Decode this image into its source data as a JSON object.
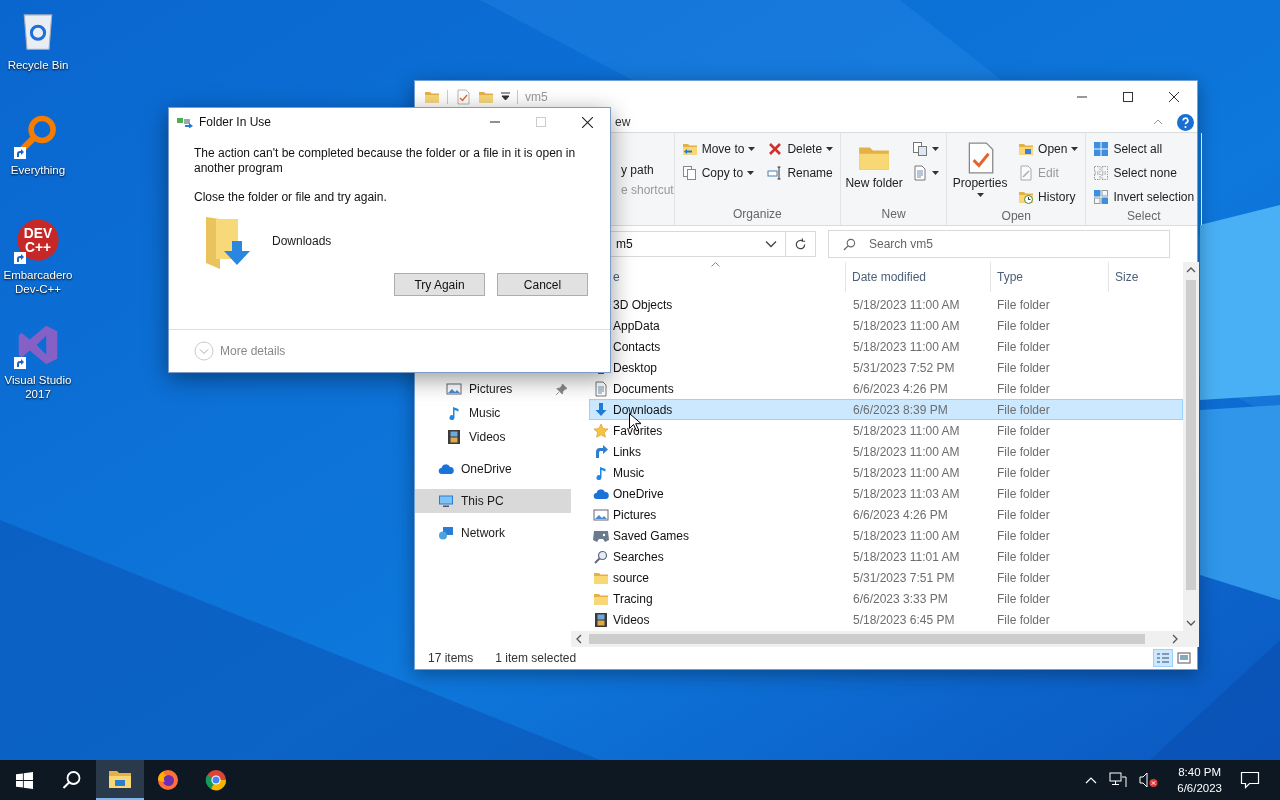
{
  "desktop_icons": [
    {
      "label": "Recycle Bin",
      "shortcut": false
    },
    {
      "label": "Everything",
      "shortcut": true
    },
    {
      "label": "Embarcadero Dev-C++",
      "shortcut": true,
      "logo_lines": [
        "DEV",
        "C++"
      ]
    },
    {
      "label": "Visual Studio 2017",
      "shortcut": true
    }
  ],
  "explorer": {
    "title": "vm5",
    "ribbon_tabs": [
      {
        "label": "ew",
        "selected": false
      }
    ],
    "clipboard_fragment": [
      {
        "label": "y path",
        "disabled": false
      },
      {
        "label": "e shortcut",
        "disabled": true
      }
    ],
    "ribbon_groups": [
      {
        "label": "Organize",
        "columns": [
          [
            {
              "label": "Move to",
              "dropdown": true,
              "disabled": false
            },
            {
              "label": "Copy to",
              "dropdown": true,
              "disabled": false
            }
          ],
          [
            {
              "label": "Delete",
              "dropdown": true,
              "disabled": false
            },
            {
              "label": "Rename",
              "dropdown": false,
              "disabled": false
            }
          ]
        ]
      },
      {
        "label": "New",
        "columns": [
          [
            {
              "label": "New folder",
              "dropdown": false,
              "disabled": false
            }
          ],
          [
            {
              "dropdown": true
            },
            {
              "dropdown": true
            }
          ]
        ]
      },
      {
        "label": "Open",
        "columns": [
          [
            {
              "label": "Properties",
              "dropdown": true,
              "disabled": false
            }
          ],
          [
            {
              "label": "Open",
              "dropdown": true,
              "disabled": false
            },
            {
              "label": "Edit",
              "dropdown": false,
              "disabled": true
            },
            {
              "label": "History",
              "dropdown": false,
              "disabled": false
            }
          ]
        ]
      },
      {
        "label": "Select",
        "columns": [
          [
            {
              "label": "Select all",
              "dropdown": false,
              "disabled": false
            },
            {
              "label": "Select none",
              "dropdown": false,
              "disabled": false
            },
            {
              "label": "Invert selection",
              "dropdown": false,
              "disabled": false
            }
          ]
        ]
      }
    ],
    "address": "m5",
    "search": {
      "placeholder": "Search vm5"
    },
    "columns": [
      "e",
      "Date modified",
      "Type",
      "Size"
    ],
    "navigation": [
      {
        "label": "Pictures",
        "kind": "pinned",
        "pinned": true,
        "selected": false
      },
      {
        "label": "Music",
        "kind": "pinned",
        "pinned": false,
        "selected": false
      },
      {
        "label": "Videos",
        "kind": "pinned",
        "pinned": false,
        "selected": false
      },
      {
        "label": "OneDrive",
        "kind": "location",
        "pinned": false,
        "selected": false
      },
      {
        "label": "This PC",
        "kind": "location",
        "pinned": false,
        "selected": true
      },
      {
        "label": "Network",
        "kind": "location",
        "pinned": false,
        "selected": false
      }
    ],
    "rows": [
      {
        "name": "3D Objects",
        "date": "5/18/2023 11:00 AM",
        "type": "File folder",
        "selected": false
      },
      {
        "name": "AppData",
        "date": "5/18/2023 11:00 AM",
        "type": "File folder",
        "selected": false
      },
      {
        "name": "Contacts",
        "date": "5/18/2023 11:00 AM",
        "type": "File folder",
        "selected": false
      },
      {
        "name": "Desktop",
        "date": "5/31/2023 7:52 PM",
        "type": "File folder",
        "selected": false
      },
      {
        "name": "Documents",
        "date": "6/6/2023 4:26 PM",
        "type": "File folder",
        "selected": false
      },
      {
        "name": "Downloads",
        "date": "6/6/2023 8:39 PM",
        "type": "File folder",
        "selected": true
      },
      {
        "name": "Favorites",
        "date": "5/18/2023 11:00 AM",
        "type": "File folder",
        "selected": false
      },
      {
        "name": "Links",
        "date": "5/18/2023 11:00 AM",
        "type": "File folder",
        "selected": false
      },
      {
        "name": "Music",
        "date": "5/18/2023 11:00 AM",
        "type": "File folder",
        "selected": false
      },
      {
        "name": "OneDrive",
        "date": "5/18/2023 11:03 AM",
        "type": "File folder",
        "selected": false
      },
      {
        "name": "Pictures",
        "date": "6/6/2023 4:26 PM",
        "type": "File folder",
        "selected": false
      },
      {
        "name": "Saved Games",
        "date": "5/18/2023 11:00 AM",
        "type": "File folder",
        "selected": false
      },
      {
        "name": "Searches",
        "date": "5/18/2023 11:01 AM",
        "type": "File folder",
        "selected": false
      },
      {
        "name": "source",
        "date": "5/31/2023 7:51 PM",
        "type": "File folder",
        "selected": false
      },
      {
        "name": "Tracing",
        "date": "6/6/2023 3:33 PM",
        "type": "File folder",
        "selected": false
      },
      {
        "name": "Videos",
        "date": "5/18/2023 6:45 PM",
        "type": "File folder",
        "selected": false
      }
    ],
    "status": {
      "count": "17 items",
      "selection": "1 item selected"
    }
  },
  "dialog": {
    "title": "Folder In Use",
    "can_maximize": false,
    "message": "The action can't be completed because the folder or a file in it is open in another program",
    "hint": "Close the folder or file and try again.",
    "item": "Downloads",
    "buttons": [
      "Try Again",
      "Cancel"
    ],
    "details": "More details"
  },
  "taskbar": {
    "apps": [
      {
        "active": true
      },
      {
        "active": false
      },
      {
        "active": false
      }
    ],
    "time": "8:40 PM",
    "date": "6/6/2023"
  }
}
